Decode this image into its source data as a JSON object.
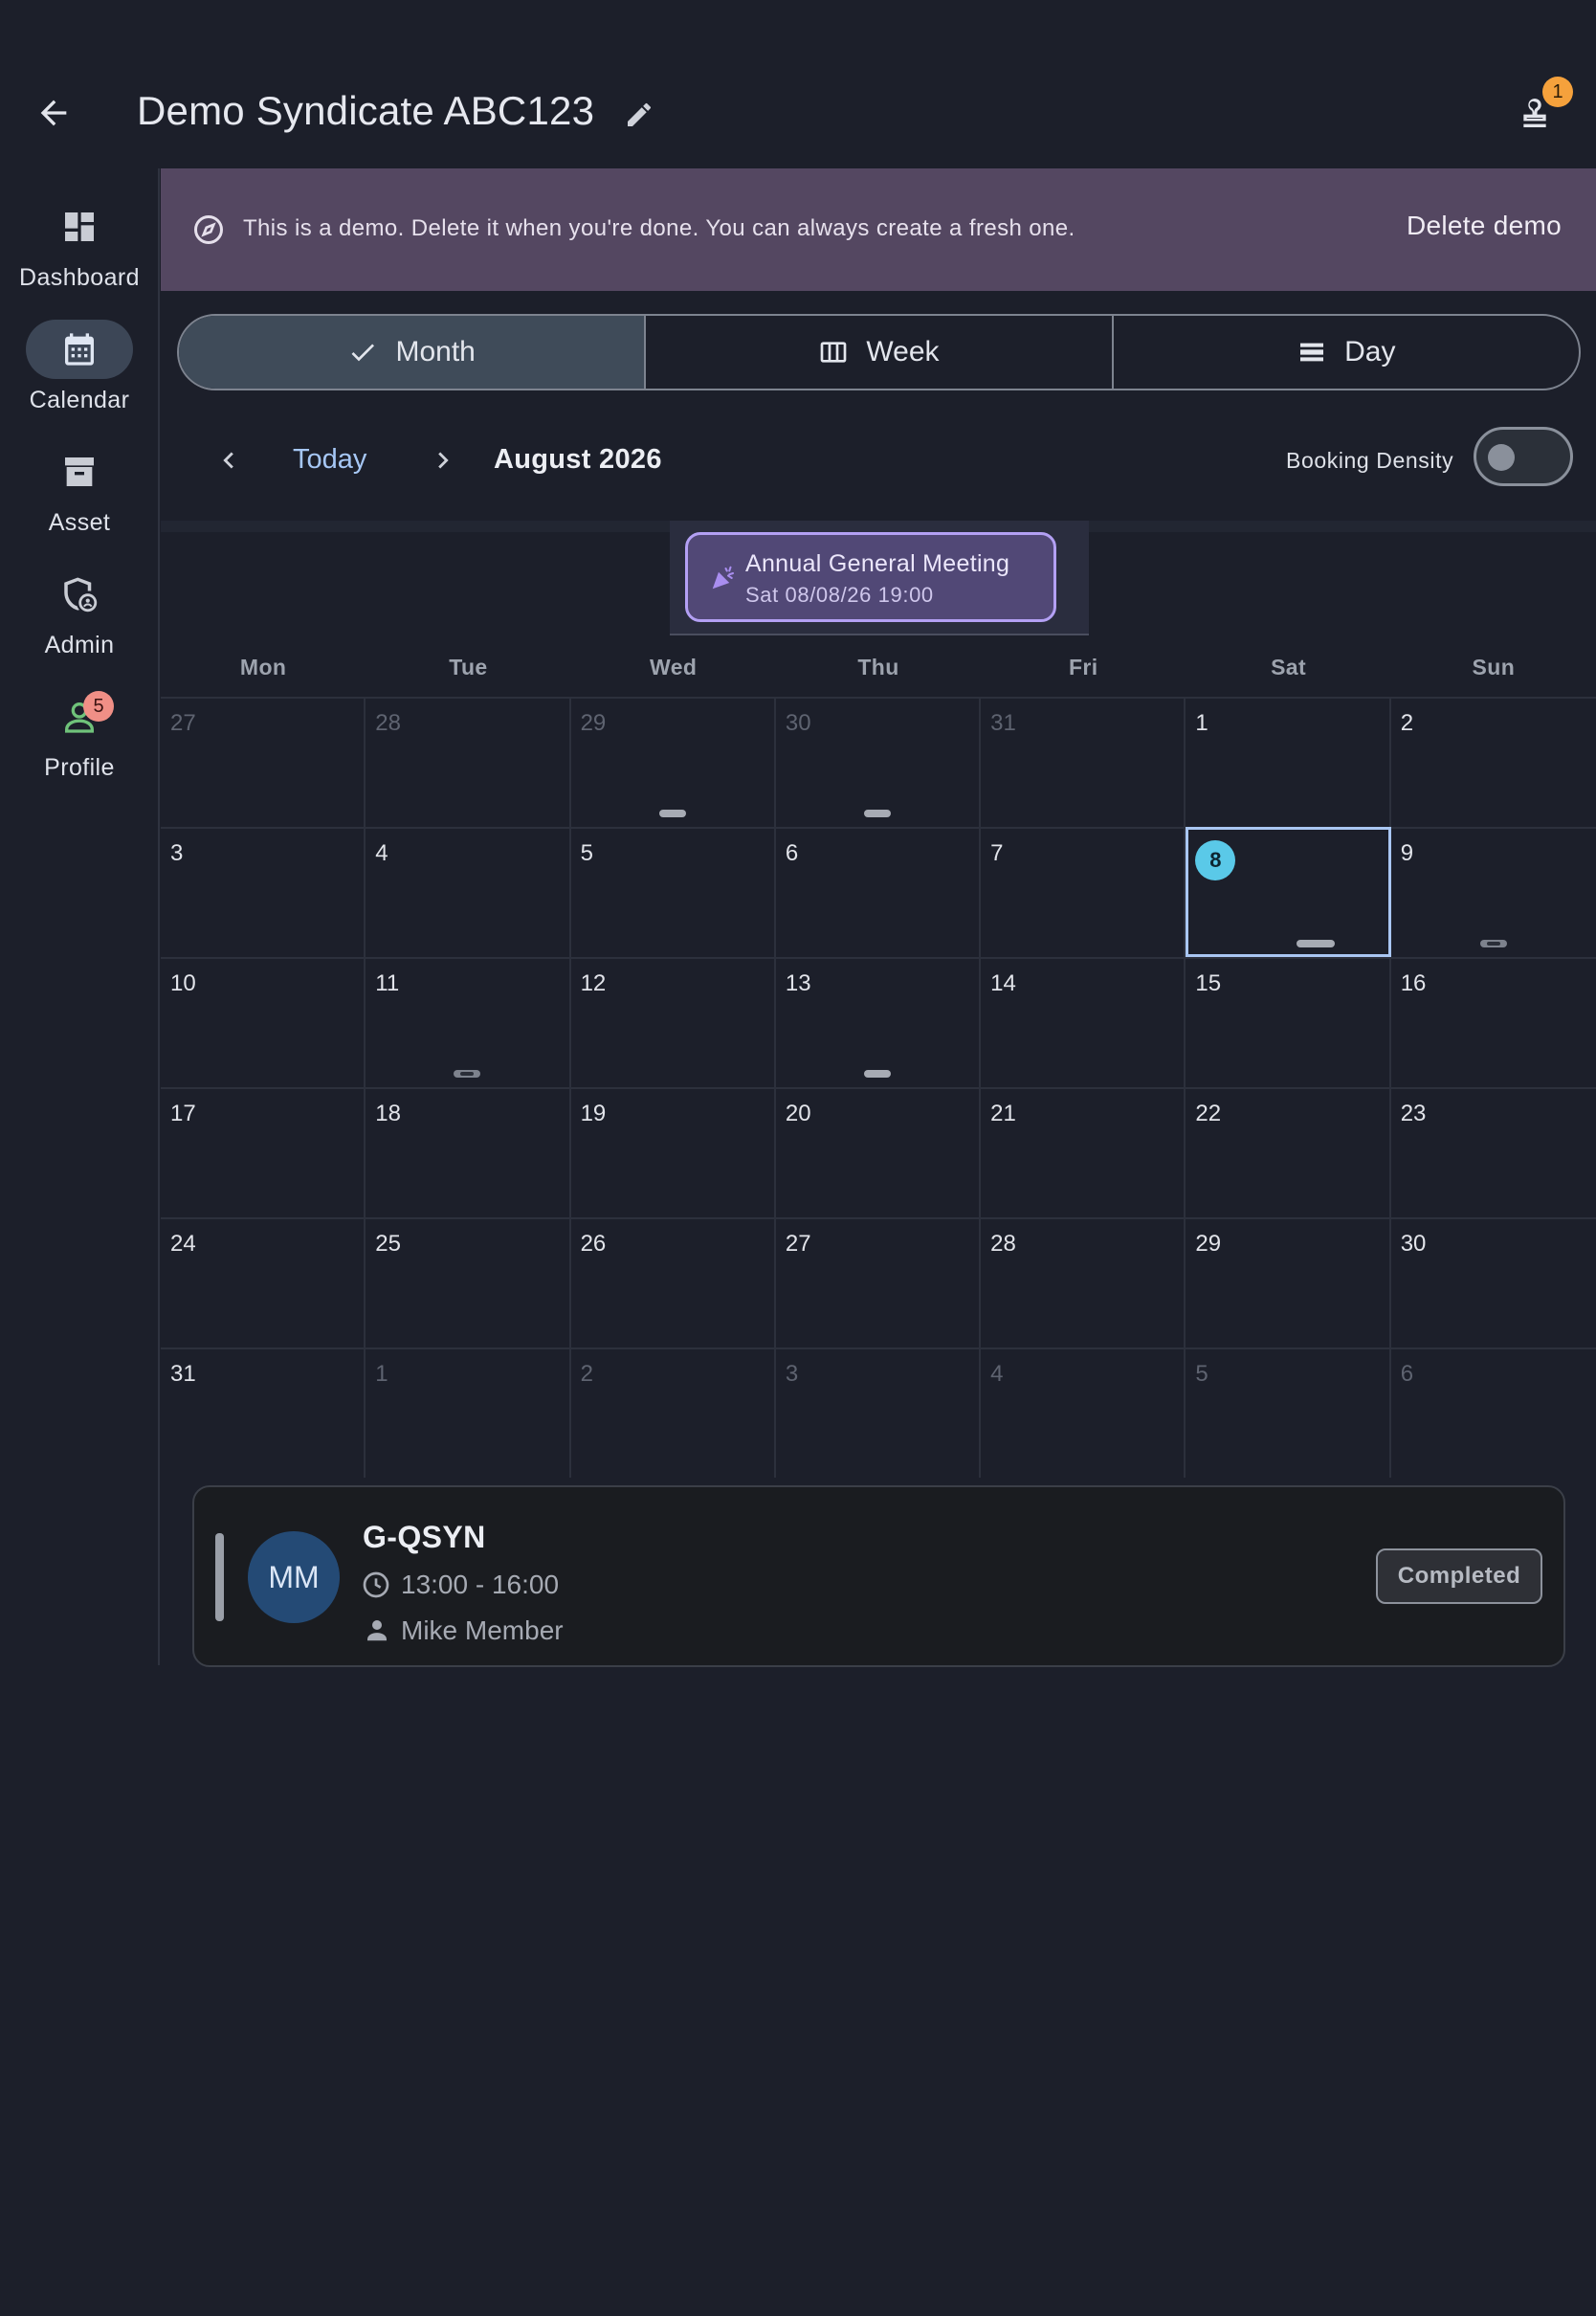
{
  "header": {
    "title": "Demo Syndicate ABC123",
    "notification_count": "1"
  },
  "sidebar": {
    "items": [
      {
        "label": "Dashboard",
        "icon": "dashboard-icon",
        "active": false
      },
      {
        "label": "Calendar",
        "icon": "calendar-icon",
        "active": true
      },
      {
        "label": "Asset",
        "icon": "archive-icon",
        "active": false
      },
      {
        "label": "Admin",
        "icon": "admin-shield-icon",
        "active": false
      },
      {
        "label": "Profile",
        "icon": "profile-icon",
        "active": false,
        "badge": "5"
      }
    ]
  },
  "banner": {
    "text": "This is a demo. Delete it when you're done. You can always create a fresh one.",
    "action": "Delete demo",
    "color": "#544761"
  },
  "views": {
    "month": "Month",
    "week": "Week",
    "day": "Day",
    "selected": "Month"
  },
  "nav": {
    "today": "Today",
    "month_label": "August 2026",
    "density_label": "Booking Density",
    "density_on": false
  },
  "event": {
    "title": "Annual General Meeting",
    "subtitle": "Sat 08/08/26 19:00"
  },
  "calendar": {
    "weekdays": [
      "Mon",
      "Tue",
      "Wed",
      "Thu",
      "Fri",
      "Sat",
      "Sun"
    ],
    "days": [
      {
        "n": "27",
        "muted": true
      },
      {
        "n": "28",
        "muted": true
      },
      {
        "n": "29",
        "muted": true,
        "marker": "solid"
      },
      {
        "n": "30",
        "muted": true,
        "marker": "solid"
      },
      {
        "n": "31",
        "muted": true
      },
      {
        "n": "1"
      },
      {
        "n": "2"
      },
      {
        "n": "3"
      },
      {
        "n": "4"
      },
      {
        "n": "5"
      },
      {
        "n": "6"
      },
      {
        "n": "7"
      },
      {
        "n": "8",
        "selected": true,
        "marker": "solid"
      },
      {
        "n": "9",
        "marker": "split"
      },
      {
        "n": "10"
      },
      {
        "n": "11",
        "marker": "split"
      },
      {
        "n": "12"
      },
      {
        "n": "13",
        "marker": "solid"
      },
      {
        "n": "14"
      },
      {
        "n": "15"
      },
      {
        "n": "16"
      },
      {
        "n": "17"
      },
      {
        "n": "18"
      },
      {
        "n": "19"
      },
      {
        "n": "20"
      },
      {
        "n": "21"
      },
      {
        "n": "22"
      },
      {
        "n": "23"
      },
      {
        "n": "24"
      },
      {
        "n": "25"
      },
      {
        "n": "26"
      },
      {
        "n": "27"
      },
      {
        "n": "28"
      },
      {
        "n": "29"
      },
      {
        "n": "30"
      },
      {
        "n": "31"
      },
      {
        "n": "1",
        "muted": true
      },
      {
        "n": "2",
        "muted": true
      },
      {
        "n": "3",
        "muted": true
      },
      {
        "n": "4",
        "muted": true
      },
      {
        "n": "5",
        "muted": true
      },
      {
        "n": "6",
        "muted": true
      }
    ]
  },
  "booking": {
    "title": "G-QSYN",
    "time": "13:00 - 16:00",
    "person": "Mike Member",
    "initials": "MM",
    "status": "Completed"
  }
}
